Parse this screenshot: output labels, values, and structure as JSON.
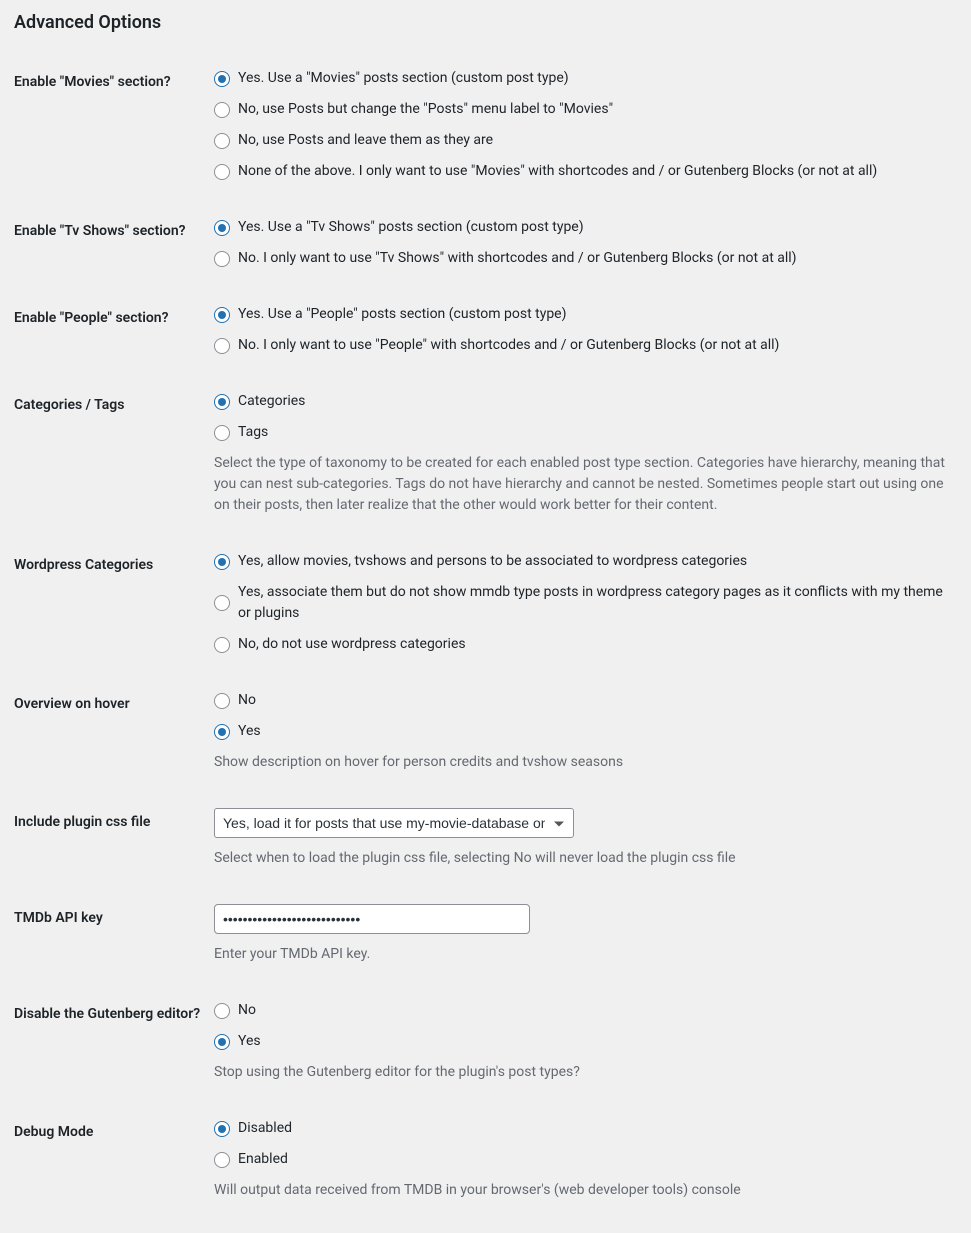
{
  "heading": "Advanced Options",
  "fields": {
    "movies": {
      "label": "Enable \"Movies\" section?",
      "options": [
        "Yes. Use a \"Movies\" posts section (custom post type)",
        "No, use Posts but change the \"Posts\" menu label to \"Movies\"",
        "No, use Posts and leave them as they are",
        "None of the above. I only want to use \"Movies\" with shortcodes and / or Gutenberg Blocks (or not at all)"
      ]
    },
    "tvshows": {
      "label": "Enable \"Tv Shows\" section?",
      "options": [
        "Yes. Use a \"Tv Shows\" posts section (custom post type)",
        "No. I only want to use \"Tv Shows\" with shortcodes and / or Gutenberg Blocks (or not at all)"
      ]
    },
    "people": {
      "label": "Enable \"People\" section?",
      "options": [
        "Yes. Use a \"People\" posts section (custom post type)",
        "No. I only want to use \"People\" with shortcodes and / or Gutenberg Blocks (or not at all)"
      ]
    },
    "taxonomy": {
      "label": "Categories / Tags",
      "options": [
        "Categories",
        "Tags"
      ],
      "description": "Select the type of taxonomy to be created for each enabled post type section. Categories have hierarchy, meaning that you can nest sub-categories. Tags do not have hierarchy and cannot be nested. Sometimes people start out using one on their posts, then later realize that the other would work better for their content."
    },
    "wpcategories": {
      "label": "Wordpress Categories",
      "options": [
        "Yes, allow movies, tvshows and persons to be associated to wordpress categories",
        "Yes, associate them but do not show mmdb type posts in wordpress category pages as it conflicts with my theme or plugins",
        "No, do not use wordpress categories"
      ]
    },
    "hover": {
      "label": "Overview on hover",
      "options": [
        "No",
        "Yes"
      ],
      "description": "Show description on hover for person credits and tvshow seasons"
    },
    "css": {
      "label": "Include plugin css file",
      "selected": "Yes, load it for posts that use my-movie-database only",
      "description": "Select when to load the plugin css file, selecting No will never load the plugin css file"
    },
    "apikey": {
      "label": "TMDb API key",
      "value": "••••••••••••••••••••••••••••",
      "description": "Enter your TMDb API key."
    },
    "gutenberg": {
      "label": "Disable the Gutenberg editor?",
      "options": [
        "No",
        "Yes"
      ],
      "description": "Stop using the Gutenberg editor for the plugin's post types?"
    },
    "debug": {
      "label": "Debug Mode",
      "options": [
        "Disabled",
        "Enabled"
      ],
      "description": "Will output data received from TMDB in your browser's (web developer tools) console"
    }
  }
}
